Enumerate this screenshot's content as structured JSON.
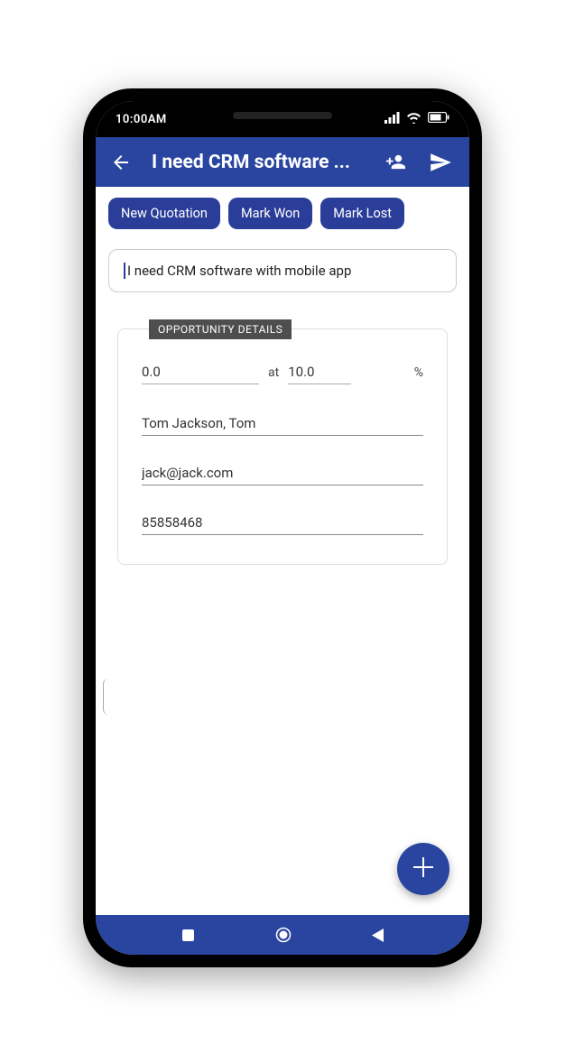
{
  "status": {
    "time": "10:00AM"
  },
  "header": {
    "title": "I need CRM software ..."
  },
  "actions": {
    "new_quotation": "New Quotation",
    "mark_won": "Mark Won",
    "mark_lost": "Mark Lost"
  },
  "subject": "I need CRM software with mobile app",
  "details": {
    "legend": "OPPORTUNITY DETAILS",
    "amount": "0.0",
    "at_label": "at",
    "probability": "10.0",
    "percent_symbol": "%",
    "contact": "Tom Jackson, Tom",
    "email": "jack@jack.com",
    "phone": "85858468"
  }
}
